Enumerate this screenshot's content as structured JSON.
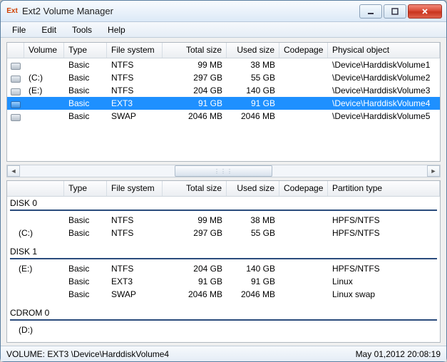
{
  "app": {
    "icon_label": "Ext",
    "title": "Ext2 Volume Manager"
  },
  "menu": {
    "file": "File",
    "edit": "Edit",
    "tools": "Tools",
    "help": "Help"
  },
  "top": {
    "headers": {
      "volume": "Volume",
      "type": "Type",
      "fs": "File system",
      "total": "Total size",
      "used": "Used size",
      "codepage": "Codepage",
      "phys": "Physical object"
    },
    "rows": [
      {
        "vol": "",
        "type": "Basic",
        "fs": "NTFS",
        "total": "99 MB",
        "used": "38 MB",
        "codepage": "",
        "phys": "\\Device\\HarddiskVolume1",
        "selected": false,
        "icon": "disk"
      },
      {
        "vol": "(C:)",
        "type": "Basic",
        "fs": "NTFS",
        "total": "297 GB",
        "used": "55 GB",
        "codepage": "",
        "phys": "\\Device\\HarddiskVolume2",
        "selected": false,
        "icon": "disk"
      },
      {
        "vol": "(E:)",
        "type": "Basic",
        "fs": "NTFS",
        "total": "204 GB",
        "used": "140 GB",
        "codepage": "",
        "phys": "\\Device\\HarddiskVolume3",
        "selected": false,
        "icon": "disk"
      },
      {
        "vol": "",
        "type": "Basic",
        "fs": "EXT3",
        "total": "91 GB",
        "used": "91 GB",
        "codepage": "",
        "phys": "\\Device\\HarddiskVolume4",
        "selected": true,
        "icon": "disk-blue"
      },
      {
        "vol": "",
        "type": "Basic",
        "fs": "SWAP",
        "total": "2046 MB",
        "used": "2046 MB",
        "codepage": "",
        "phys": "\\Device\\HarddiskVolume5",
        "selected": false,
        "icon": "disk"
      }
    ]
  },
  "bottom": {
    "headers": {
      "lead": "",
      "type": "Type",
      "fs": "File system",
      "total": "Total size",
      "used": "Used size",
      "codepage": "Codepage",
      "pt": "Partition type"
    },
    "disks": [
      {
        "name": "DISK 0",
        "rows": [
          {
            "lead": "",
            "type": "Basic",
            "fs": "NTFS",
            "total": "99 MB",
            "used": "38 MB",
            "codepage": "",
            "pt": "HPFS/NTFS"
          },
          {
            "lead": "(C:)",
            "type": "Basic",
            "fs": "NTFS",
            "total": "297 GB",
            "used": "55 GB",
            "codepage": "",
            "pt": "HPFS/NTFS"
          }
        ]
      },
      {
        "name": "DISK 1",
        "rows": [
          {
            "lead": "(E:)",
            "type": "Basic",
            "fs": "NTFS",
            "total": "204 GB",
            "used": "140 GB",
            "codepage": "",
            "pt": "HPFS/NTFS"
          },
          {
            "lead": "",
            "type": "Basic",
            "fs": "EXT3",
            "total": "91 GB",
            "used": "91 GB",
            "codepage": "",
            "pt": "Linux"
          },
          {
            "lead": "",
            "type": "Basic",
            "fs": "SWAP",
            "total": "2046 MB",
            "used": "2046 MB",
            "codepage": "",
            "pt": "Linux swap"
          }
        ]
      },
      {
        "name": "CDROM 0",
        "rows": [
          {
            "lead": "(D:)",
            "type": "",
            "fs": "",
            "total": "",
            "used": "",
            "codepage": "",
            "pt": ""
          }
        ]
      }
    ]
  },
  "status": {
    "left": "VOLUME:  EXT3 \\Device\\HarddiskVolume4",
    "right": "May 01,2012 20:08:19"
  }
}
